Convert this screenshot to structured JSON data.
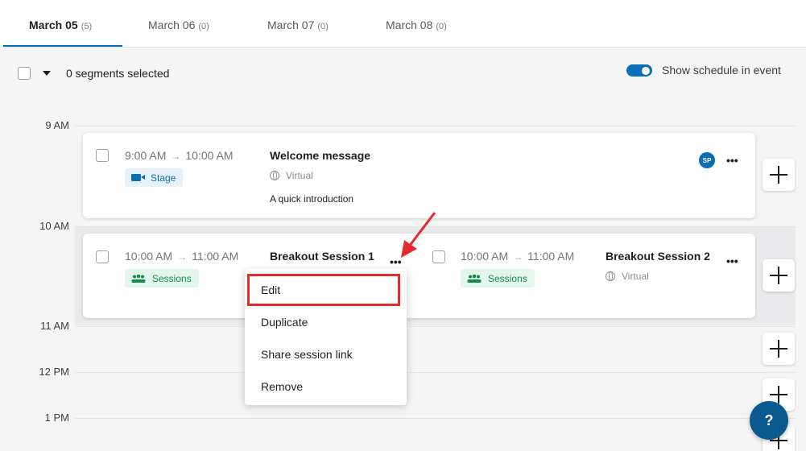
{
  "tabs": [
    {
      "label": "March 05",
      "count": "(5)"
    },
    {
      "label": "March 06",
      "count": "(0)"
    },
    {
      "label": "March 07",
      "count": "(0)"
    },
    {
      "label": "March 08",
      "count": "(0)"
    }
  ],
  "toolbar": {
    "segments_selected": "0 segments selected",
    "show_schedule_label": "Show schedule in event",
    "show_schedule_on": true
  },
  "timeline": {
    "hours": [
      "9 AM",
      "10 AM",
      "11 AM",
      "12 PM",
      "1 PM"
    ]
  },
  "sessions": [
    {
      "start": "9:00 AM",
      "end": "10:00 AM",
      "badge": "Stage",
      "title": "Welcome message",
      "location": "Virtual",
      "description": "A quick introduction",
      "avatar": "SP"
    },
    {
      "start": "10:00 AM",
      "end": "11:00 AM",
      "badge": "Sessions",
      "title": "Breakout Session 1"
    },
    {
      "start": "10:00 AM",
      "end": "11:00 AM",
      "badge": "Sessions",
      "title": "Breakout Session 2",
      "location": "Virtual"
    }
  ],
  "context_menu": {
    "items": [
      "Edit",
      "Duplicate",
      "Share session link",
      "Remove"
    ]
  },
  "more_glyph": "•••",
  "arrow_glyph": "→",
  "help_glyph": "?",
  "colors": {
    "accent": "#0b6fb8",
    "stage_badge_bg": "#e6f1fa",
    "sessions_badge_bg": "#e3f6ec",
    "sessions_badge_fg": "#168a4a",
    "highlight": "#e32b2b"
  }
}
